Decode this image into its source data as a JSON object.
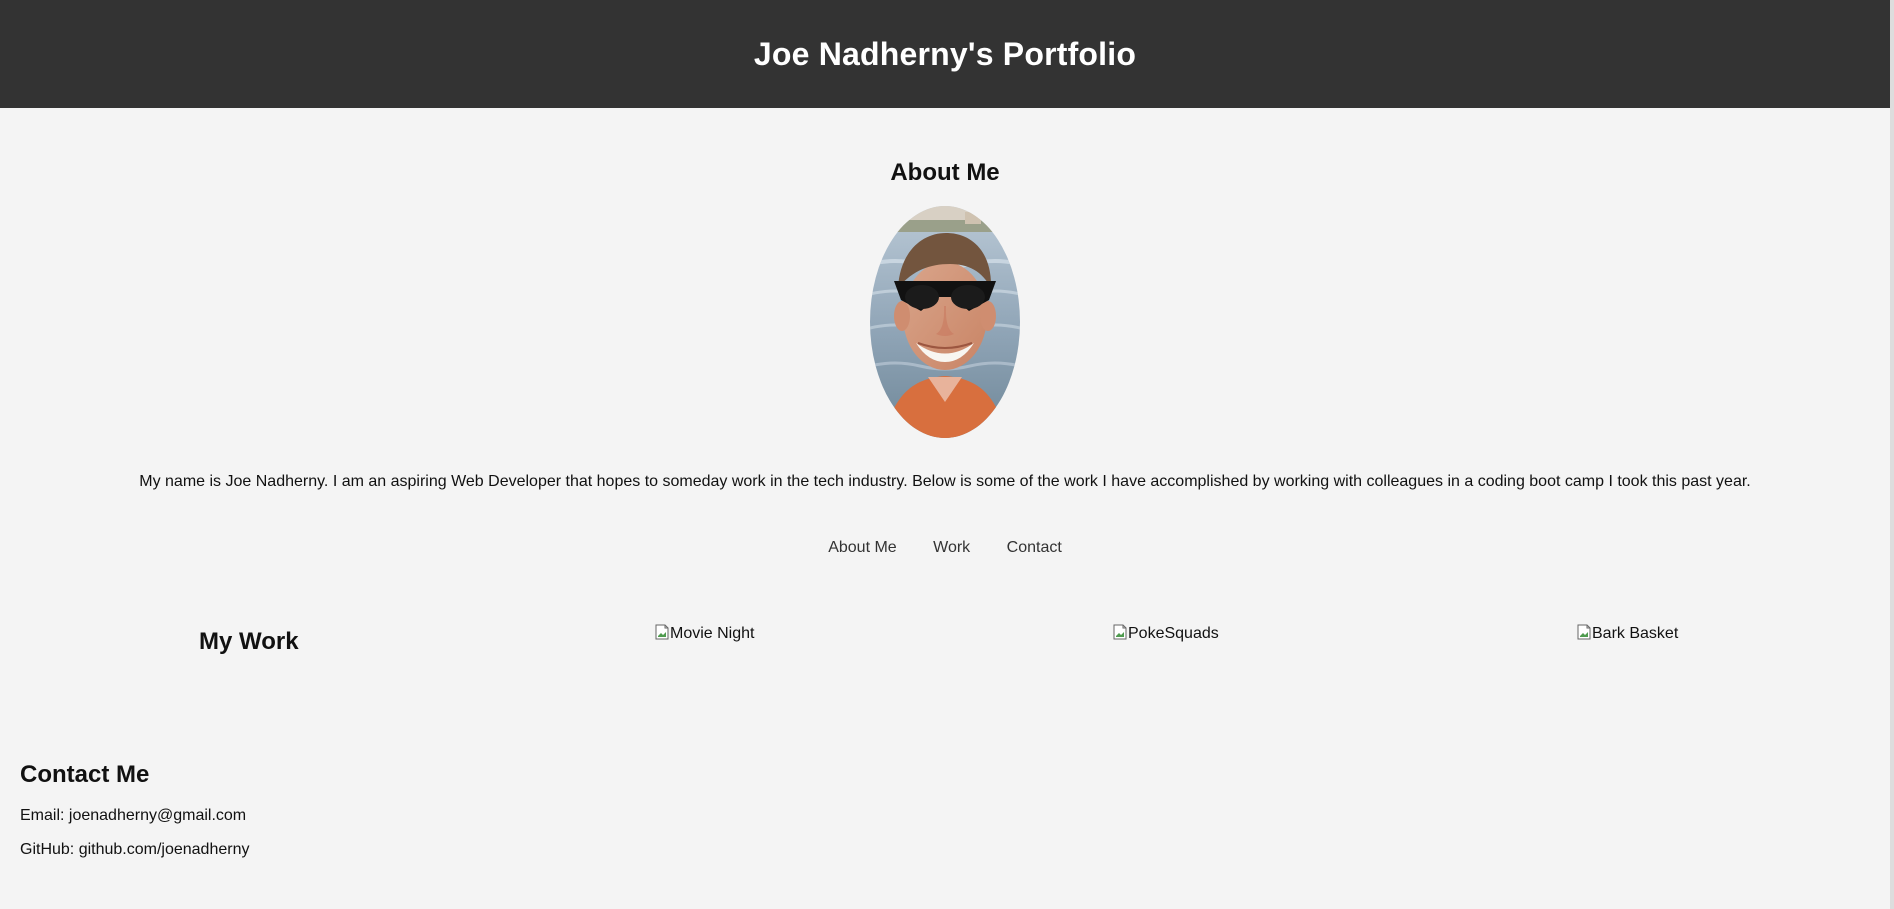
{
  "header": {
    "title": "Joe Nadherny's Portfolio"
  },
  "about": {
    "heading": "About Me",
    "portrait_alt": "Joe Nadherny",
    "bio": "My name is Joe Nadherny. I am an aspiring Web Developer that hopes to someday work in the tech industry. Below is some of the work I have accomplished by working with colleagues in a coding boot camp I took this past year."
  },
  "nav": {
    "items": [
      {
        "label": "About Me"
      },
      {
        "label": "Work"
      },
      {
        "label": "Contact"
      }
    ]
  },
  "work": {
    "heading": "My Work",
    "projects": [
      {
        "alt": "Movie Night"
      },
      {
        "alt": "PokeSquads"
      },
      {
        "alt": "Bark Basket"
      }
    ]
  },
  "contact": {
    "heading": "Contact Me",
    "email": "Email: joenadherny@gmail.com",
    "github": "GitHub: github.com/joenadherny"
  },
  "colors": {
    "header_bg": "#333333",
    "page_bg": "#f4f4f4",
    "nav_text": "#333333"
  }
}
